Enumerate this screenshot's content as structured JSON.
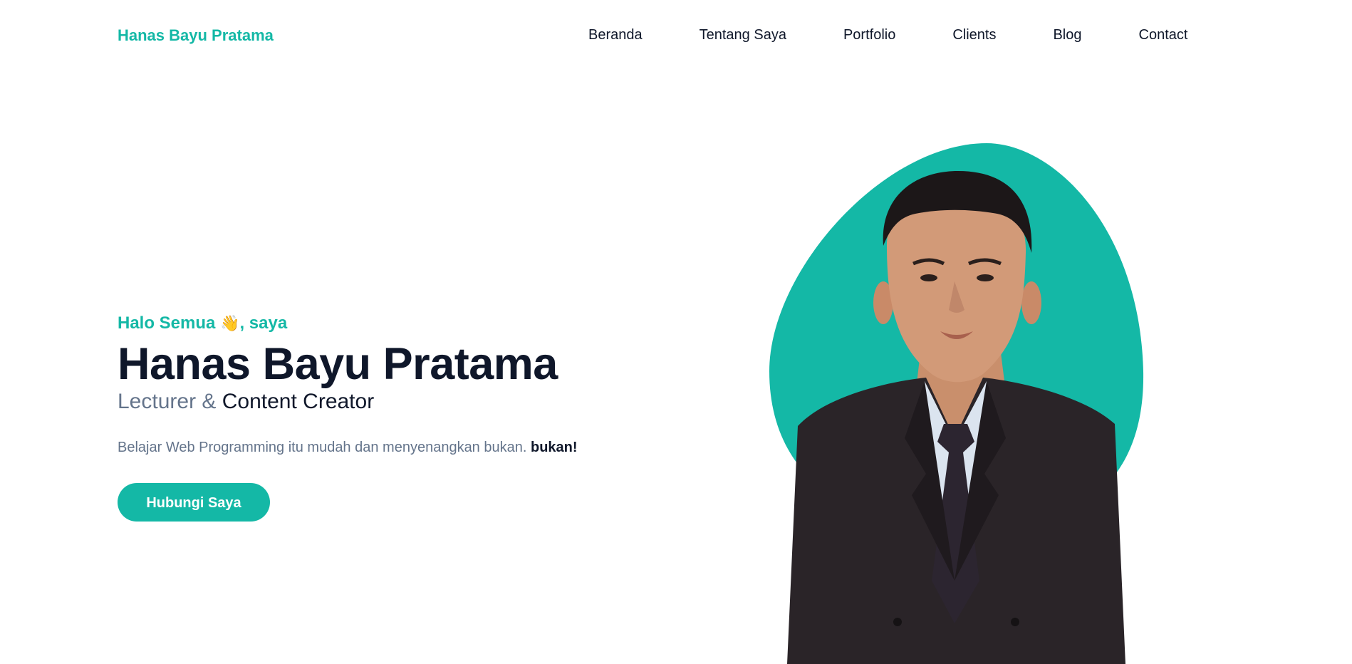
{
  "brand": {
    "name": "Hanas Bayu Pratama"
  },
  "nav": {
    "items": [
      "Beranda",
      "Tentang Saya",
      "Portfolio",
      "Clients",
      "Blog",
      "Contact"
    ]
  },
  "hero": {
    "greeting_prefix": "Halo Semua",
    "wave_emoji": "👋",
    "greeting_suffix": ", saya",
    "name": "Hanas Bayu Pratama",
    "role_muted": "Lecturer &",
    "role_strong": "Content Creator",
    "tagline": "Belajar Web Programming itu mudah dan menyenangkan bukan.",
    "tagline_bold": "bukan!",
    "cta_label": "Hubungi Saya"
  },
  "colors": {
    "accent": "#14b8a6",
    "heading": "#0f172a",
    "muted": "#64748b"
  },
  "image": {
    "portrait": "profile-photo"
  }
}
